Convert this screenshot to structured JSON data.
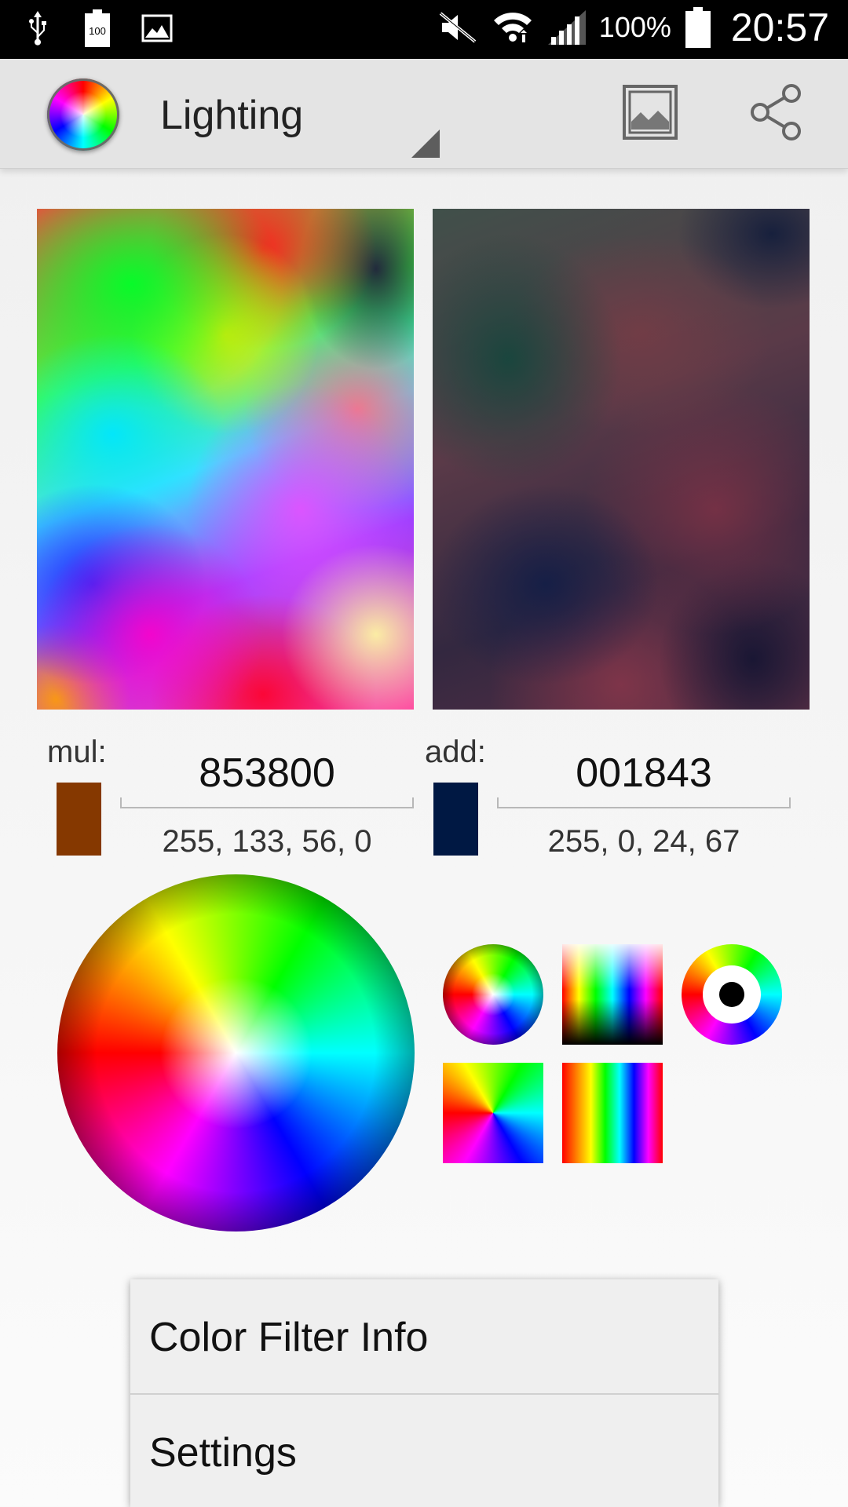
{
  "status_bar": {
    "battery_percent": "100%",
    "time": "20:57",
    "battery_icon_label": "100",
    "icons_left": [
      "usb-icon",
      "battery-100-icon",
      "image-icon"
    ],
    "icons_right": [
      "mute-icon",
      "wifi-icon",
      "signal-icon",
      "battery-icon"
    ]
  },
  "action_bar": {
    "title": "Lighting",
    "actions": [
      "image-icon",
      "share-icon"
    ]
  },
  "filter": {
    "mul_label": "mul:",
    "mul_hex": "853800",
    "mul_rgba": "255, 133, 56, 0",
    "mul_color": "#853800",
    "add_label": "add:",
    "add_hex": "001843",
    "add_rgba": "255, 0, 24, 67",
    "add_color": "#001843"
  },
  "palettes": [
    "color-wheel",
    "spectrum-gradient",
    "hue-ring",
    "hue-square",
    "rainbow-stripes"
  ],
  "menu": {
    "items": [
      {
        "label": "Color Filter Info"
      },
      {
        "label": "Settings"
      }
    ]
  }
}
